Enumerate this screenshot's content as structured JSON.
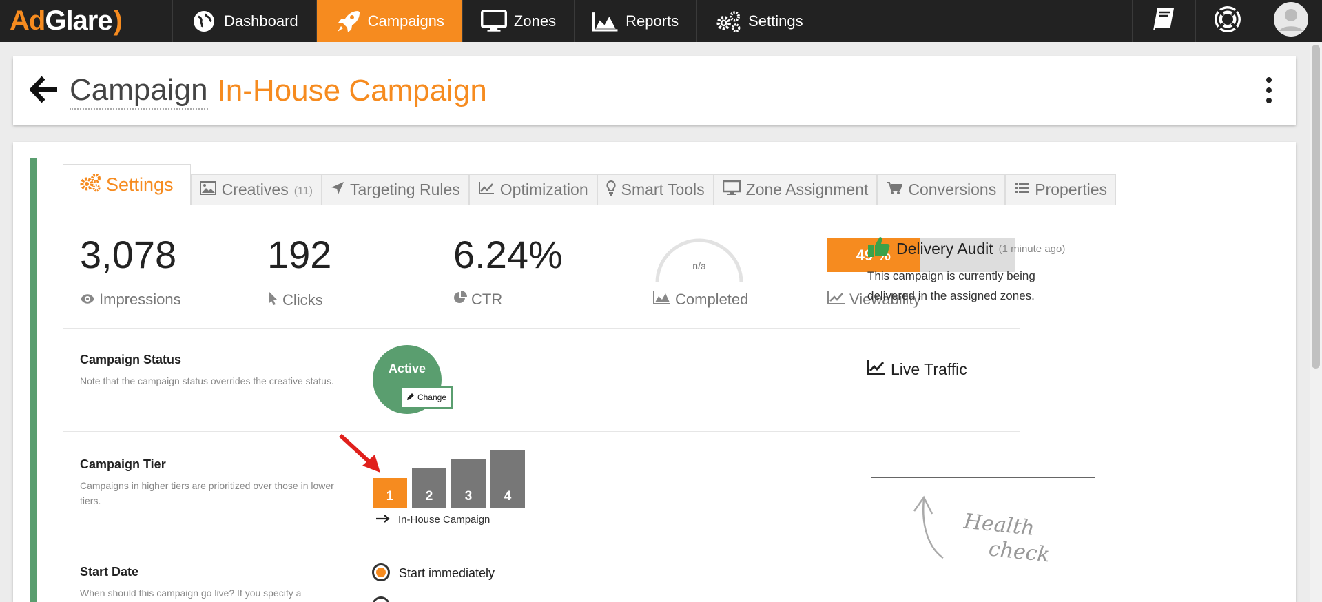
{
  "app": {
    "logo_part1": "Ad",
    "logo_part2": "Glare",
    "logo_part3": ")"
  },
  "nav": {
    "items": [
      {
        "label": "Dashboard",
        "icon": "globe-icon"
      },
      {
        "label": "Campaigns",
        "icon": "rocket-icon",
        "active": true
      },
      {
        "label": "Zones",
        "icon": "monitor-icon"
      },
      {
        "label": "Reports",
        "icon": "area-chart-icon"
      },
      {
        "label": "Settings",
        "icon": "gears-icon"
      }
    ],
    "right_icons": [
      "book-icon",
      "lifebuoy-icon",
      "user-avatar-icon"
    ]
  },
  "header": {
    "label": "Campaign",
    "name": "In-House Campaign"
  },
  "tabs": [
    {
      "label": "Settings",
      "icon": "gears-icon",
      "active": true
    },
    {
      "label": "Creatives",
      "count": "(11)",
      "icon": "image-icon"
    },
    {
      "label": "Targeting Rules",
      "icon": "location-arrow-icon"
    },
    {
      "label": "Optimization",
      "icon": "line-chart-icon"
    },
    {
      "label": "Smart Tools",
      "icon": "lightbulb-icon"
    },
    {
      "label": "Zone Assignment",
      "icon": "monitor-icon"
    },
    {
      "label": "Conversions",
      "icon": "cart-icon"
    },
    {
      "label": "Properties",
      "icon": "list-icon"
    }
  ],
  "stats": {
    "impressions": {
      "value": "3,078",
      "label": "Impressions"
    },
    "clicks": {
      "value": "192",
      "label": "Clicks"
    },
    "ctr": {
      "value": "6.24%",
      "label": "CTR"
    },
    "completed": {
      "value": "n/a",
      "label": "Completed"
    },
    "viewability": {
      "value": "49 %",
      "percent": 49,
      "label": "Viewability"
    }
  },
  "status": {
    "title": "Campaign Status",
    "desc": "Note that the campaign status overrides the creative status.",
    "value": "Active",
    "change_label": "Change",
    "color": "#5a9e6f"
  },
  "tier": {
    "title": "Campaign Tier",
    "desc": "Campaigns in higher tiers are prioritized over those in lower tiers.",
    "options": [
      "1",
      "2",
      "3",
      "4"
    ],
    "selected": "1",
    "caption": "In-House Campaign"
  },
  "start": {
    "title": "Start Date",
    "desc": "When should this campaign go live? If you specify a",
    "option1": "Start immediately"
  },
  "audit": {
    "title": "Delivery Audit",
    "ago": "(1 minute ago)",
    "text": "This campaign is currently being delivered in the assigned zones."
  },
  "live": {
    "title": "Live Traffic"
  },
  "health": {
    "line1": "Health",
    "line2": "check"
  },
  "colors": {
    "accent": "#f68b1f",
    "success": "#5a9e6f",
    "navbar": "#222222"
  }
}
